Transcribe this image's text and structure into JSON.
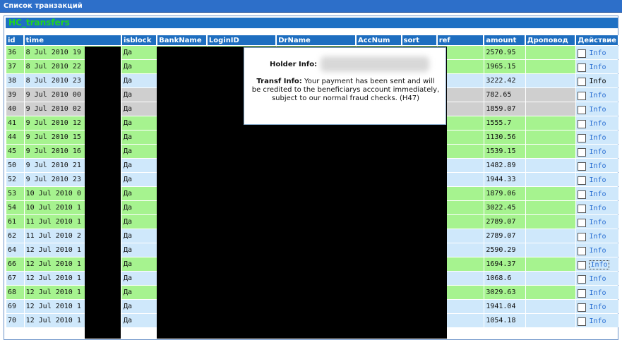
{
  "panel_title": "Список транзакций",
  "table_title": "HC_transfers",
  "columns": [
    "id",
    "time",
    "isblock",
    "BankName",
    "LoginID",
    "DrName",
    "AccNum",
    "sort",
    "ref",
    "amount",
    "Дроповод",
    "Действие"
  ],
  "action_label": "Info",
  "rows": [
    {
      "id": "36",
      "time": "8 Jul 2010 19",
      "isblock": "Да",
      "amount": "2570.95",
      "row_color": "green"
    },
    {
      "id": "37",
      "time": "8 Jul 2010 22",
      "isblock": "Да",
      "amount": "1965.15",
      "row_color": "green"
    },
    {
      "id": "38",
      "time": "8 Jul 2010 23",
      "isblock": "Да",
      "amount": "3222.42",
      "row_color": "blue"
    },
    {
      "id": "39",
      "time": "9 Jul 2010 00",
      "isblock": "Да",
      "amount": "782.65",
      "row_color": "gray"
    },
    {
      "id": "40",
      "time": "9 Jul 2010 02",
      "isblock": "Да",
      "amount": "1859.07",
      "row_color": "gray"
    },
    {
      "id": "41",
      "time": "9 Jul 2010 12",
      "isblock": "Да",
      "amount": "1555.7",
      "row_color": "green"
    },
    {
      "id": "44",
      "time": "9 Jul 2010 15",
      "isblock": "Да",
      "amount": "1130.56",
      "row_color": "green"
    },
    {
      "id": "45",
      "time": "9 Jul 2010 16",
      "isblock": "Да",
      "amount": "1539.15",
      "row_color": "green"
    },
    {
      "id": "50",
      "time": "9 Jul 2010 21",
      "isblock": "Да",
      "amount": "1482.89",
      "row_color": "blue"
    },
    {
      "id": "52",
      "time": "9 Jul 2010 23",
      "isblock": "Да",
      "amount": "1944.33",
      "row_color": "blue"
    },
    {
      "id": "53",
      "time": "10 Jul 2010 0",
      "isblock": "Да",
      "amount": "1879.06",
      "row_color": "green"
    },
    {
      "id": "54",
      "time": "10 Jul 2010 1",
      "isblock": "Да",
      "amount": "3022.45",
      "row_color": "green"
    },
    {
      "id": "61",
      "time": "11 Jul 2010 1",
      "isblock": "Да",
      "amount": "2789.07",
      "row_color": "green"
    },
    {
      "id": "62",
      "time": "11 Jul 2010 2",
      "isblock": "Да",
      "amount": "2789.07",
      "row_color": "blue"
    },
    {
      "id": "64",
      "time": "12 Jul 2010 1",
      "isblock": "Да",
      "amount": "2590.29",
      "row_color": "blue"
    },
    {
      "id": "66",
      "time": "12 Jul 2010 1",
      "isblock": "Да",
      "amount": "1694.37",
      "row_color": "green"
    },
    {
      "id": "67",
      "time": "12 Jul 2010 1",
      "isblock": "Да",
      "amount": "1068.6",
      "row_color": "blue"
    },
    {
      "id": "68",
      "time": "12 Jul 2010 1",
      "isblock": "Да",
      "amount": "3029.63",
      "row_color": "green"
    },
    {
      "id": "69",
      "time": "12 Jul 2010 1",
      "isblock": "Да",
      "amount": "1941.04",
      "row_color": "blue"
    },
    {
      "id": "70",
      "time": "12 Jul 2010 1",
      "isblock": "Да",
      "amount": "1054.18",
      "row_color": "blue"
    }
  ],
  "popup": {
    "holder_label": "Holder Info:",
    "transf_label": "Transf Info:",
    "transf_text": "Your payment has been sent and will be credited to the beneficiarys account immediately, subject to our normal fraud checks. (H47)"
  }
}
